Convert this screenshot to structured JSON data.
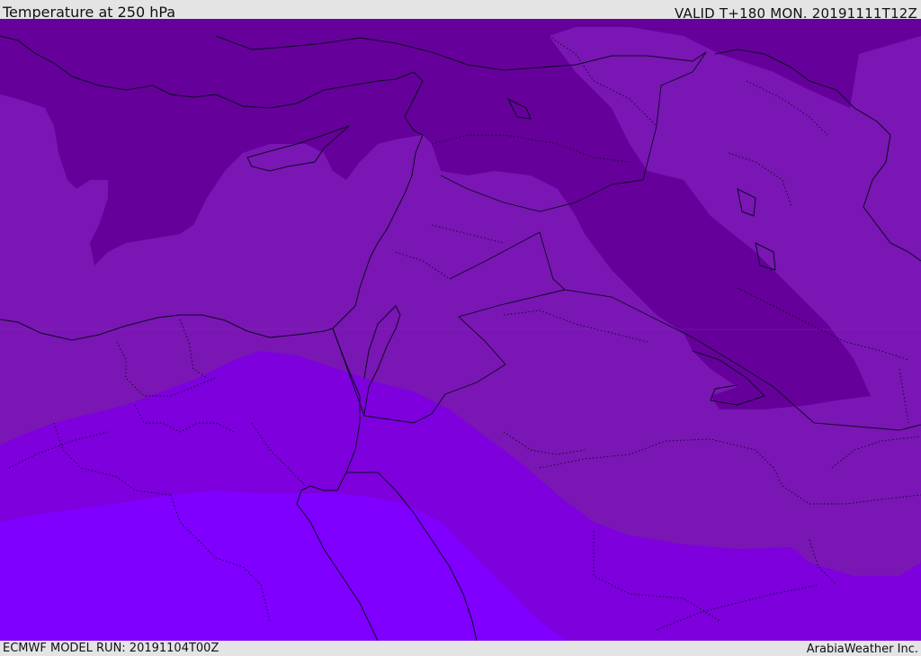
{
  "header": {
    "title": "Temperature at 250 hPa",
    "valid_time": "VALID T+180 MON. 20191111T12Z"
  },
  "footer": {
    "model_run": "ECMWF MODEL RUN: 20191104T00Z",
    "credit": "ArabiaWeather Inc."
  },
  "map": {
    "variable": "temperature",
    "level": "250 hPa",
    "colors": {
      "coldest": "#66009a",
      "cold": "#7510b1",
      "mid": "#7a1cb9",
      "warm": "#7d00dd",
      "warmest": "#7f00ff",
      "coastline": "#0a0a20",
      "border": "#0a0a20"
    }
  }
}
